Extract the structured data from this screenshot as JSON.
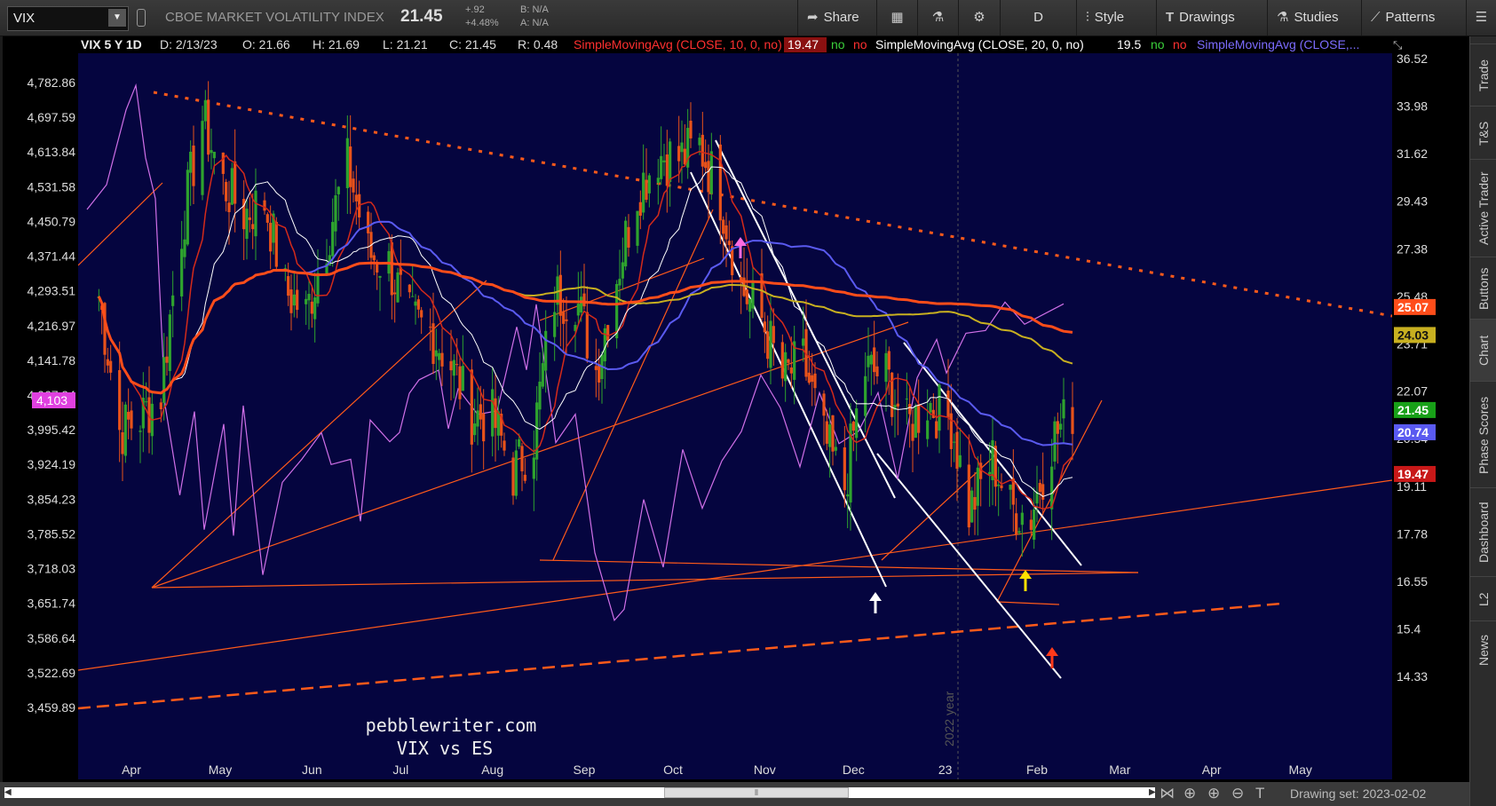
{
  "toolbar": {
    "symbol": "VIX",
    "company": "CBOE MARKET VOLATILITY INDEX",
    "last": "21.45",
    "change": "+.92",
    "change_pct": "+4.48%",
    "bid": "B: N/A",
    "ask": "A: N/A",
    "buttons": {
      "share": "Share",
      "period": "D",
      "style": "Style",
      "drawings": "Drawings",
      "studies": "Studies",
      "patterns": "Patterns"
    }
  },
  "header": {
    "title": "VIX 5 Y 1D",
    "date": "D: 2/13/23",
    "open": "O: 21.66",
    "high": "H: 21.69",
    "low": "L: 21.21",
    "close": "C: 21.45",
    "range": "R: 0.48",
    "studies": [
      {
        "label": "SimpleMovingAvg (CLOSE, 10, 0, no)",
        "value": "19.47",
        "color": "#ff3030"
      },
      {
        "label": "SimpleMovingAvg (CLOSE, 20, 0, no)",
        "value": "19.5",
        "color": "#ffffff"
      },
      {
        "label": "SimpleMovingAvg (CLOSE,...",
        "value": "",
        "color": "#7c6cff"
      }
    ],
    "flag_no": "no"
  },
  "right_tabs": [
    "Trade",
    "T&S",
    "Active Trader",
    "Buttons",
    "Chart",
    "Phase Scores",
    "Dashboard",
    "L2",
    "News"
  ],
  "bottom": {
    "drawing_set": "Drawing set: 2023-02-02"
  },
  "annotations": {
    "watermark_line1": "pebblewriter.com",
    "watermark_line2": "VIX vs ES",
    "year_marker": "2022 year"
  },
  "colors": {
    "background": "#05053f",
    "candle_up": "#2ea32e",
    "candle_down": "#e8521a",
    "sma10": "#d42a1a",
    "sma20": "#ffffff",
    "sma50": "#5a5af0",
    "sma100": "#c8b020",
    "sma200": "#ff4d1a",
    "es_line": "#d070e8",
    "trendline": "#ff5a1a",
    "channel": "#ffffff"
  },
  "chart_data": {
    "type": "line",
    "title": "VIX 5 Y 1D",
    "xlabel": "",
    "ylabel": "",
    "x_ticks": [
      "Apr",
      "May",
      "Jun",
      "Jul",
      "Aug",
      "Sep",
      "Oct",
      "Nov",
      "Dec",
      "23",
      "Feb",
      "Mar",
      "Apr",
      "May"
    ],
    "y_right_ticks": [
      "36.52",
      "33.98",
      "31.62",
      "29.43",
      "27.38",
      "25.48",
      "23.71",
      "22.07",
      "20.54",
      "19.11",
      "17.78",
      "16.55",
      "15.4",
      "14.33"
    ],
    "y_left_ticks": [
      "4,782.86",
      "4,697.59",
      "4,613.84",
      "4,531.58",
      "4,450.79",
      "4,371.44",
      "4,293.51",
      "4,216.97",
      "4,141.78",
      "4,067.94",
      "3,995.42",
      "3,924.19",
      "3,854.23",
      "3,785.52",
      "3,718.03",
      "3,651.74",
      "3,586.64",
      "3,522.69",
      "3,459.89"
    ],
    "ylim_right": [
      14.33,
      36.52
    ],
    "y_scale": "log",
    "grid": false,
    "right_markers": [
      {
        "label": "25.07",
        "value": 25.07,
        "color": "#ff4d1a"
      },
      {
        "label": "24.03",
        "value": 24.03,
        "color": "#c8b020"
      },
      {
        "label": "21.45",
        "value": 21.45,
        "color": "#18a018"
      },
      {
        "label": "20.74",
        "value": 20.74,
        "color": "#5a5af0"
      },
      {
        "label": "19.47",
        "value": 19.47,
        "color": "#c81818"
      }
    ],
    "left_marker": {
      "label": "4,103",
      "color": "#e040e0"
    },
    "vix_close": [
      {
        "x": "2022-03-21",
        "y": 25.5
      },
      {
        "x": "2022-03-28",
        "y": 20.8
      },
      {
        "x": "2022-04-04",
        "y": 21.2
      },
      {
        "x": "2022-04-11",
        "y": 22.0
      },
      {
        "x": "2022-04-18",
        "y": 28.2
      },
      {
        "x": "2022-04-25",
        "y": 33.4
      },
      {
        "x": "2022-05-02",
        "y": 30.2
      },
      {
        "x": "2022-05-09",
        "y": 28.9
      },
      {
        "x": "2022-05-16",
        "y": 29.4
      },
      {
        "x": "2022-05-23",
        "y": 25.7
      },
      {
        "x": "2022-05-30",
        "y": 24.8
      },
      {
        "x": "2022-06-06",
        "y": 27.8
      },
      {
        "x": "2022-06-13",
        "y": 31.1
      },
      {
        "x": "2022-06-20",
        "y": 27.2
      },
      {
        "x": "2022-06-27",
        "y": 26.7
      },
      {
        "x": "2022-07-04",
        "y": 24.6
      },
      {
        "x": "2022-07-11",
        "y": 24.2
      },
      {
        "x": "2022-07-18",
        "y": 23.0
      },
      {
        "x": "2022-07-25",
        "y": 21.3
      },
      {
        "x": "2022-08-01",
        "y": 21.2
      },
      {
        "x": "2022-08-08",
        "y": 19.5
      },
      {
        "x": "2022-08-15",
        "y": 20.6
      },
      {
        "x": "2022-08-22",
        "y": 25.5
      },
      {
        "x": "2022-08-29",
        "y": 25.5
      },
      {
        "x": "2022-09-05",
        "y": 22.8
      },
      {
        "x": "2022-09-12",
        "y": 26.3
      },
      {
        "x": "2022-09-19",
        "y": 29.9
      },
      {
        "x": "2022-09-26",
        "y": 31.6
      },
      {
        "x": "2022-10-03",
        "y": 31.4
      },
      {
        "x": "2022-10-10",
        "y": 32.0
      },
      {
        "x": "2022-10-17",
        "y": 29.7
      },
      {
        "x": "2022-10-24",
        "y": 25.8
      },
      {
        "x": "2022-10-31",
        "y": 24.6
      },
      {
        "x": "2022-11-07",
        "y": 22.5
      },
      {
        "x": "2022-11-14",
        "y": 23.1
      },
      {
        "x": "2022-11-21",
        "y": 20.5
      },
      {
        "x": "2022-11-28",
        "y": 19.1
      },
      {
        "x": "2022-12-05",
        "y": 22.8
      },
      {
        "x": "2022-12-12",
        "y": 22.6
      },
      {
        "x": "2022-12-19",
        "y": 20.9
      },
      {
        "x": "2022-12-26",
        "y": 21.7
      },
      {
        "x": "2023-01-03",
        "y": 21.1
      },
      {
        "x": "2023-01-09",
        "y": 18.4
      },
      {
        "x": "2023-01-17",
        "y": 19.9
      },
      {
        "x": "2023-01-23",
        "y": 18.5
      },
      {
        "x": "2023-01-30",
        "y": 18.3
      },
      {
        "x": "2023-02-06",
        "y": 20.5
      },
      {
        "x": "2023-02-13",
        "y": 21.45
      }
    ]
  }
}
